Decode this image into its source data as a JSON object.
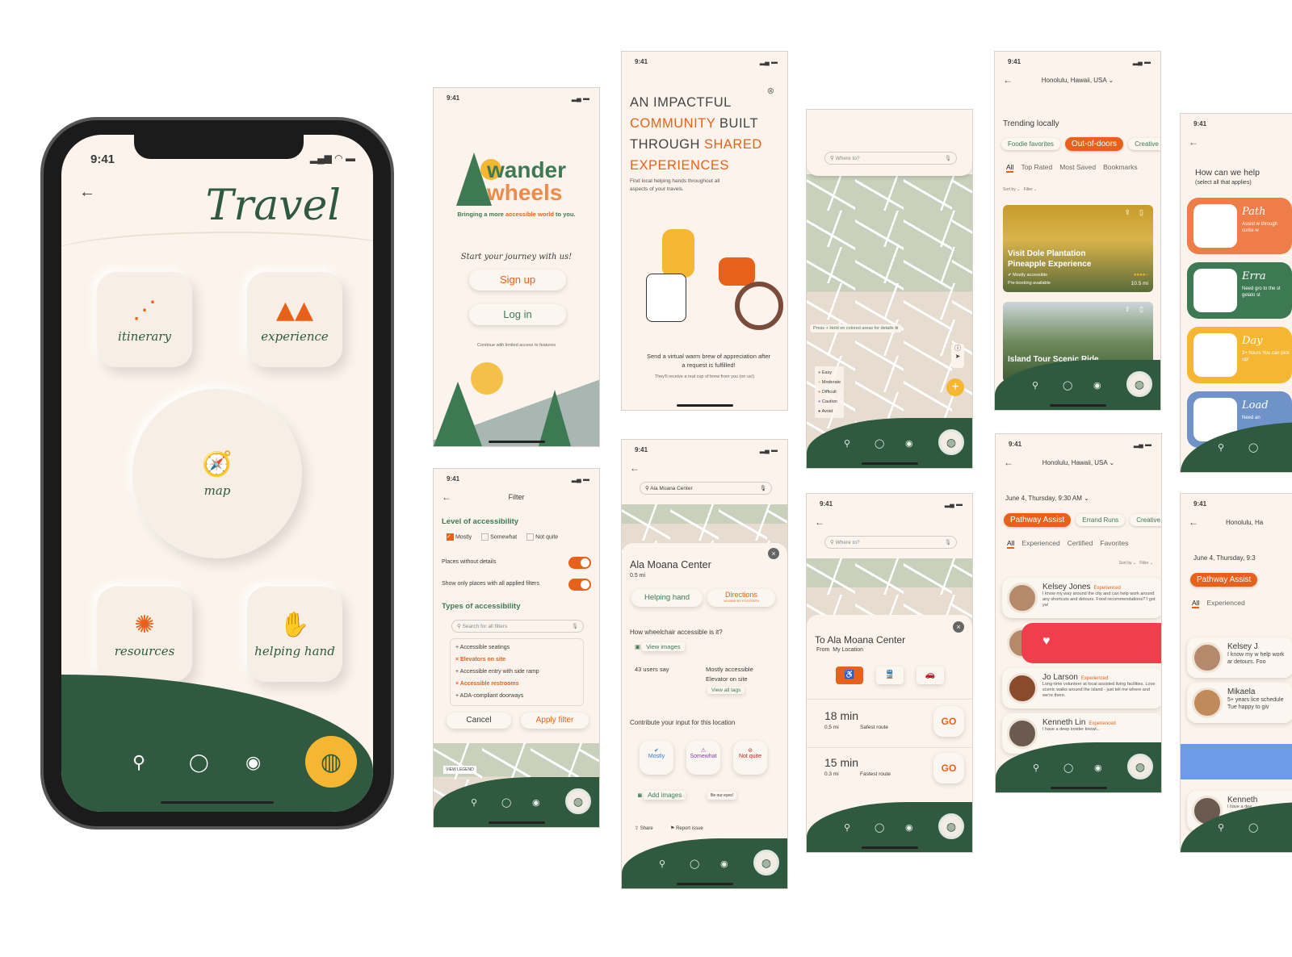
{
  "status_time": "9:41",
  "colors": {
    "primary": "#e8611a",
    "green": "#2f5a3f",
    "bg": "#fcf4ec",
    "gold": "#f5b731"
  },
  "nav_icons": [
    "search-icon",
    "chat-icon",
    "profile-icon",
    "globe-icon"
  ],
  "travel": {
    "title": "Travel",
    "tiles": [
      "itinerary",
      "experience",
      "map",
      "resources",
      "helping hand"
    ]
  },
  "login": {
    "brand_line1": "wander",
    "brand_line2": "wheels",
    "tagline_pre": "Bringing a more ",
    "tagline_accent": "accessible world",
    "tagline_post": " to you.",
    "prompt": "Start your journey with us!",
    "signup": "Sign up",
    "login": "Log in",
    "limited": "Continue with limited access to features"
  },
  "onboard": {
    "h1": "An impactful",
    "h2a": "community",
    "h2b": " built",
    "h3a": "through ",
    "h3b": "shared",
    "h4": "experiences",
    "sub": "Find local helping hands throughout all aspects of your travels.",
    "msg": "Send a virtual warm brew of appreciation after a request is fulfilled!",
    "msg_sub": "They'll receive a real cup of brew from you (on us!)"
  },
  "filter": {
    "title": "Filter",
    "level_heading": "Level of accessibility",
    "levels": [
      "Mostly",
      "Somewhat",
      "Not quite"
    ],
    "toggle1": "Places without details",
    "toggle2": "Show only places with all applied filters",
    "types_heading": "Types of accessibility",
    "search_placeholder": "Search for all filters",
    "types": [
      {
        "label": "Accessible seatings",
        "selected": false
      },
      {
        "label": "Elevators on site",
        "selected": true
      },
      {
        "label": "Accessible entry with side ramp",
        "selected": false
      },
      {
        "label": "Accessible restrooms",
        "selected": true
      },
      {
        "label": "ADA-compliant doorways",
        "selected": false
      }
    ],
    "cancel": "Cancel",
    "apply": "Apply filter",
    "view_legend": "VIEW LEGEND"
  },
  "map": {
    "search_placeholder": "Where to?",
    "hint": "Press + Hold on colored areas for details",
    "legend": [
      {
        "label": "Easy",
        "color": "#6a9a7a"
      },
      {
        "label": "Moderate",
        "color": "#f0c870"
      },
      {
        "label": "Difficult",
        "color": "#ee8a4a"
      },
      {
        "label": "Caution",
        "color": "#a07ad8"
      },
      {
        "label": "Avoid",
        "color": "#555555"
      }
    ]
  },
  "place": {
    "search_value": "Ala Moana Center",
    "name": "Ala Moana Center",
    "distance": "0.5 mi",
    "helping_hand": "Helping hand",
    "directions": "Directions",
    "directions_sub": "18 MINS BY FOOTPATH",
    "question": "How wheelchair accessible is it?",
    "view_images": "View images",
    "users_say": "43 users say",
    "summary1": "Mostly accessible",
    "summary2": "Elevator on site",
    "view_tags": "View all tags",
    "contribute": "Contribute your input for this location",
    "votes": [
      "Mostly",
      "Somewhat",
      "Not quite"
    ],
    "add_images": "Add images",
    "be_eyes": "Be our eyes!",
    "share": "Share",
    "report": "Report issue"
  },
  "directions": {
    "search_placeholder": "Where to?",
    "title": "To Ala Moana Center",
    "from_label": "From",
    "from": "My Location",
    "routes": [
      {
        "time": "18 min",
        "dist": "0.5 mi",
        "type": "Safest route"
      },
      {
        "time": "15 min",
        "dist": "0.3 mi",
        "type": "Fastest route"
      }
    ],
    "go": "GO"
  },
  "trending": {
    "location": "Honolulu, Hawaii, USA",
    "heading": "Trending locally",
    "chips": [
      "Foodie favorites",
      "Out-of-doors",
      "Creative"
    ],
    "tabs": [
      "All",
      "Top Rated",
      "Most Saved",
      "Bookmarks"
    ],
    "sort": "Sort by",
    "filter": "Filter",
    "cards": [
      {
        "title": "Visit Dole Plantation Pineapple Experience",
        "access": "Mostly accessible",
        "note": "Pre-booking available",
        "dist": "10.5 mi"
      },
      {
        "title": "Island Tour Scenic Ride"
      }
    ]
  },
  "helpers": {
    "location": "Honolulu, Hawaii, USA",
    "date": "June 4, Thursday, 9:30 AM",
    "chips": [
      "Pathway Assist",
      "Errand Runs",
      "Creative"
    ],
    "tabs": [
      "All",
      "Experienced",
      "Certified",
      "Favorites"
    ],
    "sort": "Sort by",
    "filter": "Filter",
    "people": [
      {
        "name": "Kelsey Jones",
        "badge": "Experienced",
        "bio": "I know my way around the city and can help work around any shortcuts and detours. Food recommendations? I got ya!"
      },
      {
        "name": "Jo Larson",
        "badge": "Experienced",
        "bio": "Long-time volunteer at local assisted living facilities. Love scenic walks around the island - just tell me where and we're there."
      },
      {
        "name": "Kenneth Lin",
        "badge": "Experienced",
        "bio": "I have a deep insider knowl..."
      }
    ]
  },
  "help": {
    "heading": "How can we help",
    "sub": "(select all that applies)",
    "options": [
      {
        "title": "Path",
        "desc": "Assist w through curbs w",
        "color": "#ee7d48"
      },
      {
        "title": "Erra",
        "desc": "Need gro to the st gelato st",
        "color": "#3d7a54"
      },
      {
        "title": "Day",
        "desc": "3+ hours You can pick up/",
        "color": "#f5b731"
      },
      {
        "title": "Load",
        "desc": "Need an",
        "color": "#6f93c8"
      }
    ]
  },
  "helpers2": {
    "location": "Honolulu, Ha",
    "date": "June 4, Thursday, 9:3",
    "chip": "Pathway Assist",
    "tabs": [
      "All",
      "Experienced"
    ],
    "people": [
      {
        "name": "Kelsey J",
        "bio": "I know my w help work ar detours. Foo"
      },
      {
        "name": "Mikaela",
        "bio": "5+ years lice schedule Tue happy to giv"
      },
      {
        "name": "Kenneth",
        "bio": "I have a dee"
      }
    ]
  }
}
